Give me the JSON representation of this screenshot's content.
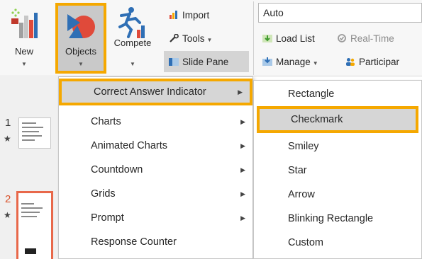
{
  "ribbon": {
    "new_label": "New",
    "objects_label": "Objects",
    "compete_label": "Compete",
    "import_label": "Import",
    "tools_label": "Tools",
    "slide_pane_label": "Slide Pane",
    "auto_value": "Auto",
    "load_list_label": "Load List",
    "realtime_label": "Real-Time",
    "manage_label": "Manage",
    "participants_label": "Participar"
  },
  "slides": [
    {
      "number": "1",
      "star": "★"
    },
    {
      "number": "2",
      "star": "★"
    }
  ],
  "main_menu": {
    "items": [
      {
        "label": "Correct Answer Indicator",
        "has_submenu": true
      },
      {
        "label": "Charts",
        "has_submenu": true
      },
      {
        "label": "Animated Charts",
        "has_submenu": true
      },
      {
        "label": "Countdown",
        "has_submenu": true
      },
      {
        "label": "Grids",
        "has_submenu": true
      },
      {
        "label": "Prompt",
        "has_submenu": true
      },
      {
        "label": "Response Counter",
        "has_submenu": false
      }
    ]
  },
  "sub_menu": {
    "items": [
      {
        "label": "Rectangle"
      },
      {
        "label": "Checkmark"
      },
      {
        "label": "Smiley"
      },
      {
        "label": "Star"
      },
      {
        "label": "Arrow"
      },
      {
        "label": "Blinking Rectangle"
      },
      {
        "label": "Custom"
      }
    ]
  },
  "colors": {
    "highlight_border": "#f5a800",
    "selected_bg": "#d6d6d6",
    "accent_red": "#e74c3c",
    "accent_blue": "#2f6fb5"
  },
  "icons": [
    "new-icon",
    "objects-icon",
    "compete-icon",
    "import-icon",
    "tools-icon",
    "slide-pane-icon",
    "load-list-icon",
    "realtime-icon",
    "manage-icon",
    "participants-icon",
    "submenu-arrow-icon",
    "star-icon"
  ]
}
